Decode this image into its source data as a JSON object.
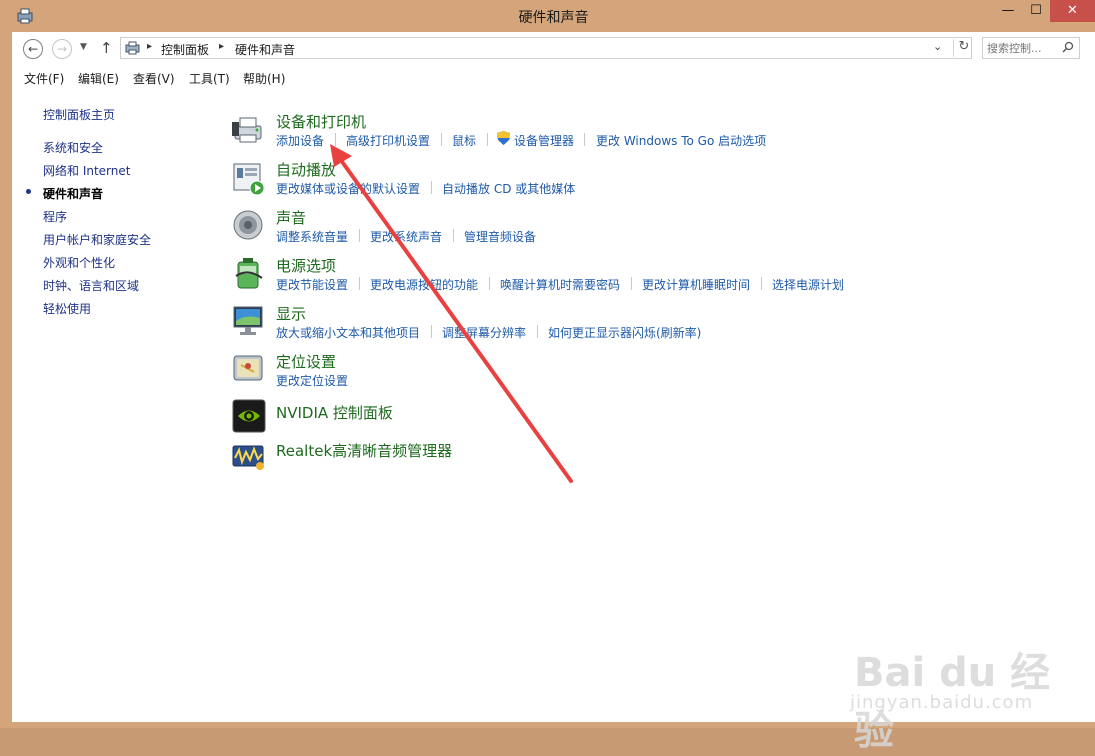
{
  "window": {
    "title": "硬件和声音",
    "min_glyph": "—",
    "max_glyph": "☐",
    "close_glyph": "✕"
  },
  "nav": {
    "back": "←",
    "forward": "→",
    "dropdown": "▼",
    "up": "↑"
  },
  "address": {
    "breadcrumbs": [
      "控制面板",
      "硬件和声音"
    ],
    "separator": "▸",
    "dropdown": "⌄",
    "refresh": "↻"
  },
  "search": {
    "placeholder": "搜索控制..."
  },
  "menu": [
    "文件(F)",
    "编辑(E)",
    "查看(V)",
    "工具(T)",
    "帮助(H)"
  ],
  "sidebar": {
    "home": "控制面板主页",
    "items": [
      {
        "label": "系统和安全"
      },
      {
        "label": "网络和 Internet"
      },
      {
        "label": "硬件和声音",
        "current": true
      },
      {
        "label": "程序"
      },
      {
        "label": "用户帐户和家庭安全"
      },
      {
        "label": "外观和个性化"
      },
      {
        "label": "时钟、语言和区域"
      },
      {
        "label": "轻松使用"
      }
    ]
  },
  "categories": [
    {
      "title": "设备和打印机",
      "icon": "printer-icon",
      "links": [
        "添加设备",
        "高级打印机设置",
        "鼠标",
        "设备管理器",
        "更改 Windows To Go 启动选项"
      ]
    },
    {
      "title": "自动播放",
      "icon": "autoplay-icon",
      "links": [
        "更改媒体或设备的默认设置",
        "自动播放 CD 或其他媒体"
      ]
    },
    {
      "title": "声音",
      "icon": "speaker-icon",
      "links": [
        "调整系统音量",
        "更改系统声音",
        "管理音频设备"
      ]
    },
    {
      "title": "电源选项",
      "icon": "battery-icon",
      "links": [
        "更改节能设置",
        "更改电源按钮的功能",
        "唤醒计算机时需要密码",
        "更改计算机睡眠时间",
        "选择电源计划"
      ]
    },
    {
      "title": "显示",
      "icon": "monitor-icon",
      "links": [
        "放大或缩小文本和其他项目",
        "调整屏幕分辨率",
        "如何更正显示器闪烁(刷新率)"
      ]
    },
    {
      "title": "定位设置",
      "icon": "location-icon",
      "links": [
        "更改定位设置"
      ]
    },
    {
      "title": "NVIDIA 控制面板",
      "icon": "nvidia-icon",
      "links": []
    },
    {
      "title": "Realtek高清晰音频管理器",
      "icon": "realtek-icon",
      "links": []
    }
  ],
  "watermark": {
    "brand": "Bai du 经验",
    "url": "jingyan.baidu.com"
  },
  "colors": {
    "frame": "#d4a57a",
    "category_title": "#1e6a1e",
    "link": "#1e5aa8",
    "sidebar_link": "#1e3287",
    "annotation_arrow": "#e8413f",
    "close_button": "#c7504a"
  }
}
